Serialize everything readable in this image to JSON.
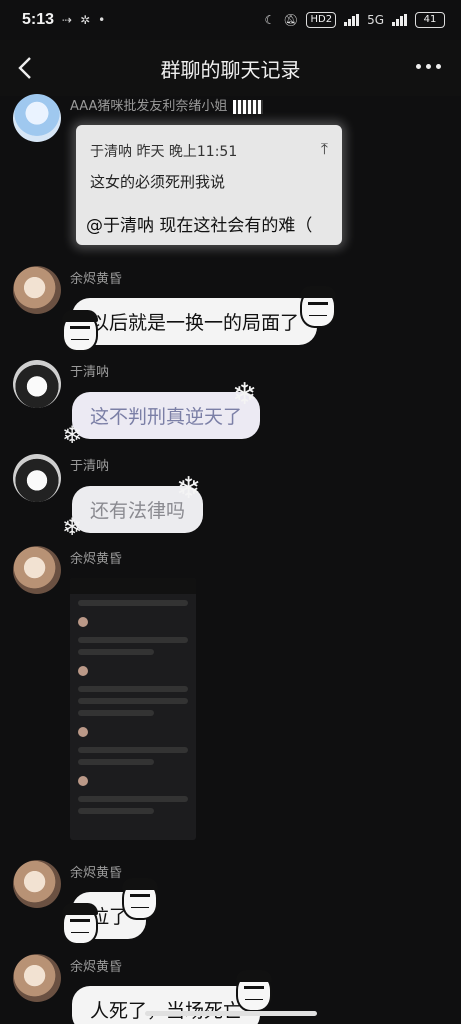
{
  "status_bar": {
    "time": "5:13",
    "hd_label": "HD2",
    "network": "5G",
    "battery": "41"
  },
  "header": {
    "title": "群聊的聊天记录"
  },
  "messages": [
    {
      "sender": "AAA猪咪批发友利奈绪小姐",
      "quote": {
        "author_time": "于清呐  昨天 晚上11:51",
        "text": "这女的必须死刑我说",
        "reply": "@于清呐 现在这社会有的难（"
      }
    },
    {
      "sender": "余烬黄昏",
      "text": "以后就是一换一的局面了"
    },
    {
      "sender": "于清呐",
      "text": "这不判刑真逆天了"
    },
    {
      "sender": "于清呐",
      "text": "还有法律吗"
    },
    {
      "sender": "余烬黄昏",
      "image": "screenshot"
    },
    {
      "sender": "余烬黄昏",
      "text": "拉了"
    },
    {
      "sender": "余烬黄昏",
      "text": "人死了，当场死亡"
    }
  ]
}
